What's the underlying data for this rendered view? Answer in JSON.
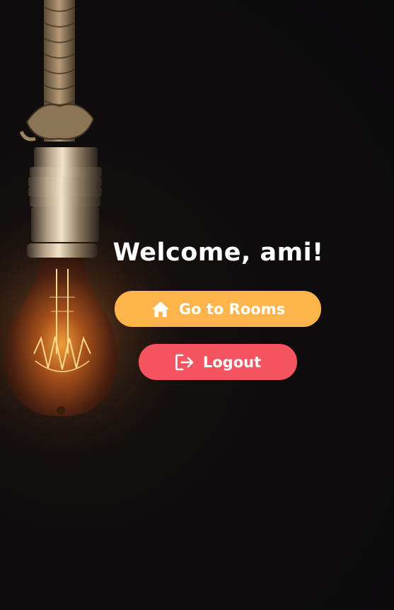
{
  "welcome": {
    "text": "Welcome, ami!"
  },
  "actions": {
    "rooms": {
      "label": "Go to Rooms",
      "icon": "home-icon",
      "color": "#fdb44b"
    },
    "logout": {
      "label": "Logout",
      "icon": "logout-icon",
      "color": "#f5535f"
    }
  }
}
